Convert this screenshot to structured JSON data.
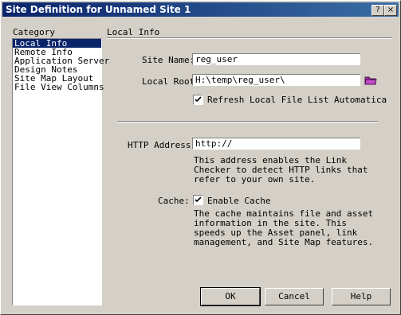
{
  "window": {
    "title": "Site Definition for Unnamed Site 1",
    "close_glyph": "×",
    "help_glyph": "?"
  },
  "category": {
    "label": "Category",
    "items": [
      "Local Info",
      "Remote Info",
      "Application Server",
      "Design Notes",
      "Site Map Layout",
      "File View Columns"
    ],
    "selected": "Local Info"
  },
  "section_title": "Local Info",
  "site_name": {
    "label": "Site Name:",
    "value": "reg_user"
  },
  "local_root": {
    "label": "Local Root",
    "value": "H:\\temp\\reg_user\\"
  },
  "refresh": {
    "label": "Refresh Local File List Automatica",
    "checked": true
  },
  "http_address": {
    "label": "HTTP Address:",
    "value": "http://",
    "desc": [
      "This address enables the Link",
      "Checker to detect HTTP links that",
      "refer to your own site."
    ]
  },
  "cache": {
    "label": "Cache:",
    "checkbox_label": "Enable Cache",
    "checked": true,
    "desc": [
      "The cache maintains file and asset",
      "information in the site.  This",
      "speeds up the Asset panel, link",
      "management, and Site Map features."
    ]
  },
  "buttons": {
    "ok": "OK",
    "cancel": "Cancel",
    "help": "Help"
  },
  "colors": {
    "titlebar": "#0a246a",
    "face": "#d4d0c8",
    "folder": "#9a2fa0"
  }
}
